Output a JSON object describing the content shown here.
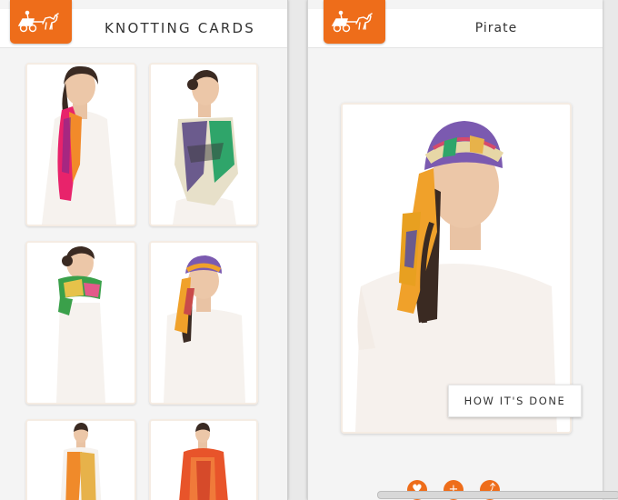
{
  "left_screen": {
    "title": "KNOTTING CARDS",
    "logo_icon": "horse-carriage-icon",
    "cards": [
      {
        "name": "card-1",
        "scarf_colors": [
          "#e8236b",
          "#f28a2a",
          "#7a2a8f"
        ]
      },
      {
        "name": "card-2",
        "scarf_colors": [
          "#6b5b8d",
          "#2fa56a",
          "#e7e0c9"
        ]
      },
      {
        "name": "card-3",
        "scarf_colors": [
          "#3aa04a",
          "#e6c24a",
          "#e35a8a"
        ]
      },
      {
        "name": "card-4",
        "scarf_colors": [
          "#f0a12a",
          "#7b5ab0",
          "#c94a4a"
        ]
      },
      {
        "name": "card-5",
        "scarf_colors": [
          "#f08a2a",
          "#e7b24a",
          "#ffffff"
        ]
      },
      {
        "name": "card-6",
        "scarf_colors": [
          "#e8542a",
          "#f07a3a",
          "#d64a2a"
        ]
      }
    ]
  },
  "right_screen": {
    "title": "Pirate",
    "logo_icon": "horse-carriage-icon",
    "how_button": "HOW IT'S DONE",
    "actions": [
      "heart-icon",
      "add-icon",
      "share-icon"
    ]
  },
  "colors": {
    "accent": "#ee6d1a",
    "header_bg": "#ffffff",
    "screen_bg": "#f4f4f4"
  }
}
